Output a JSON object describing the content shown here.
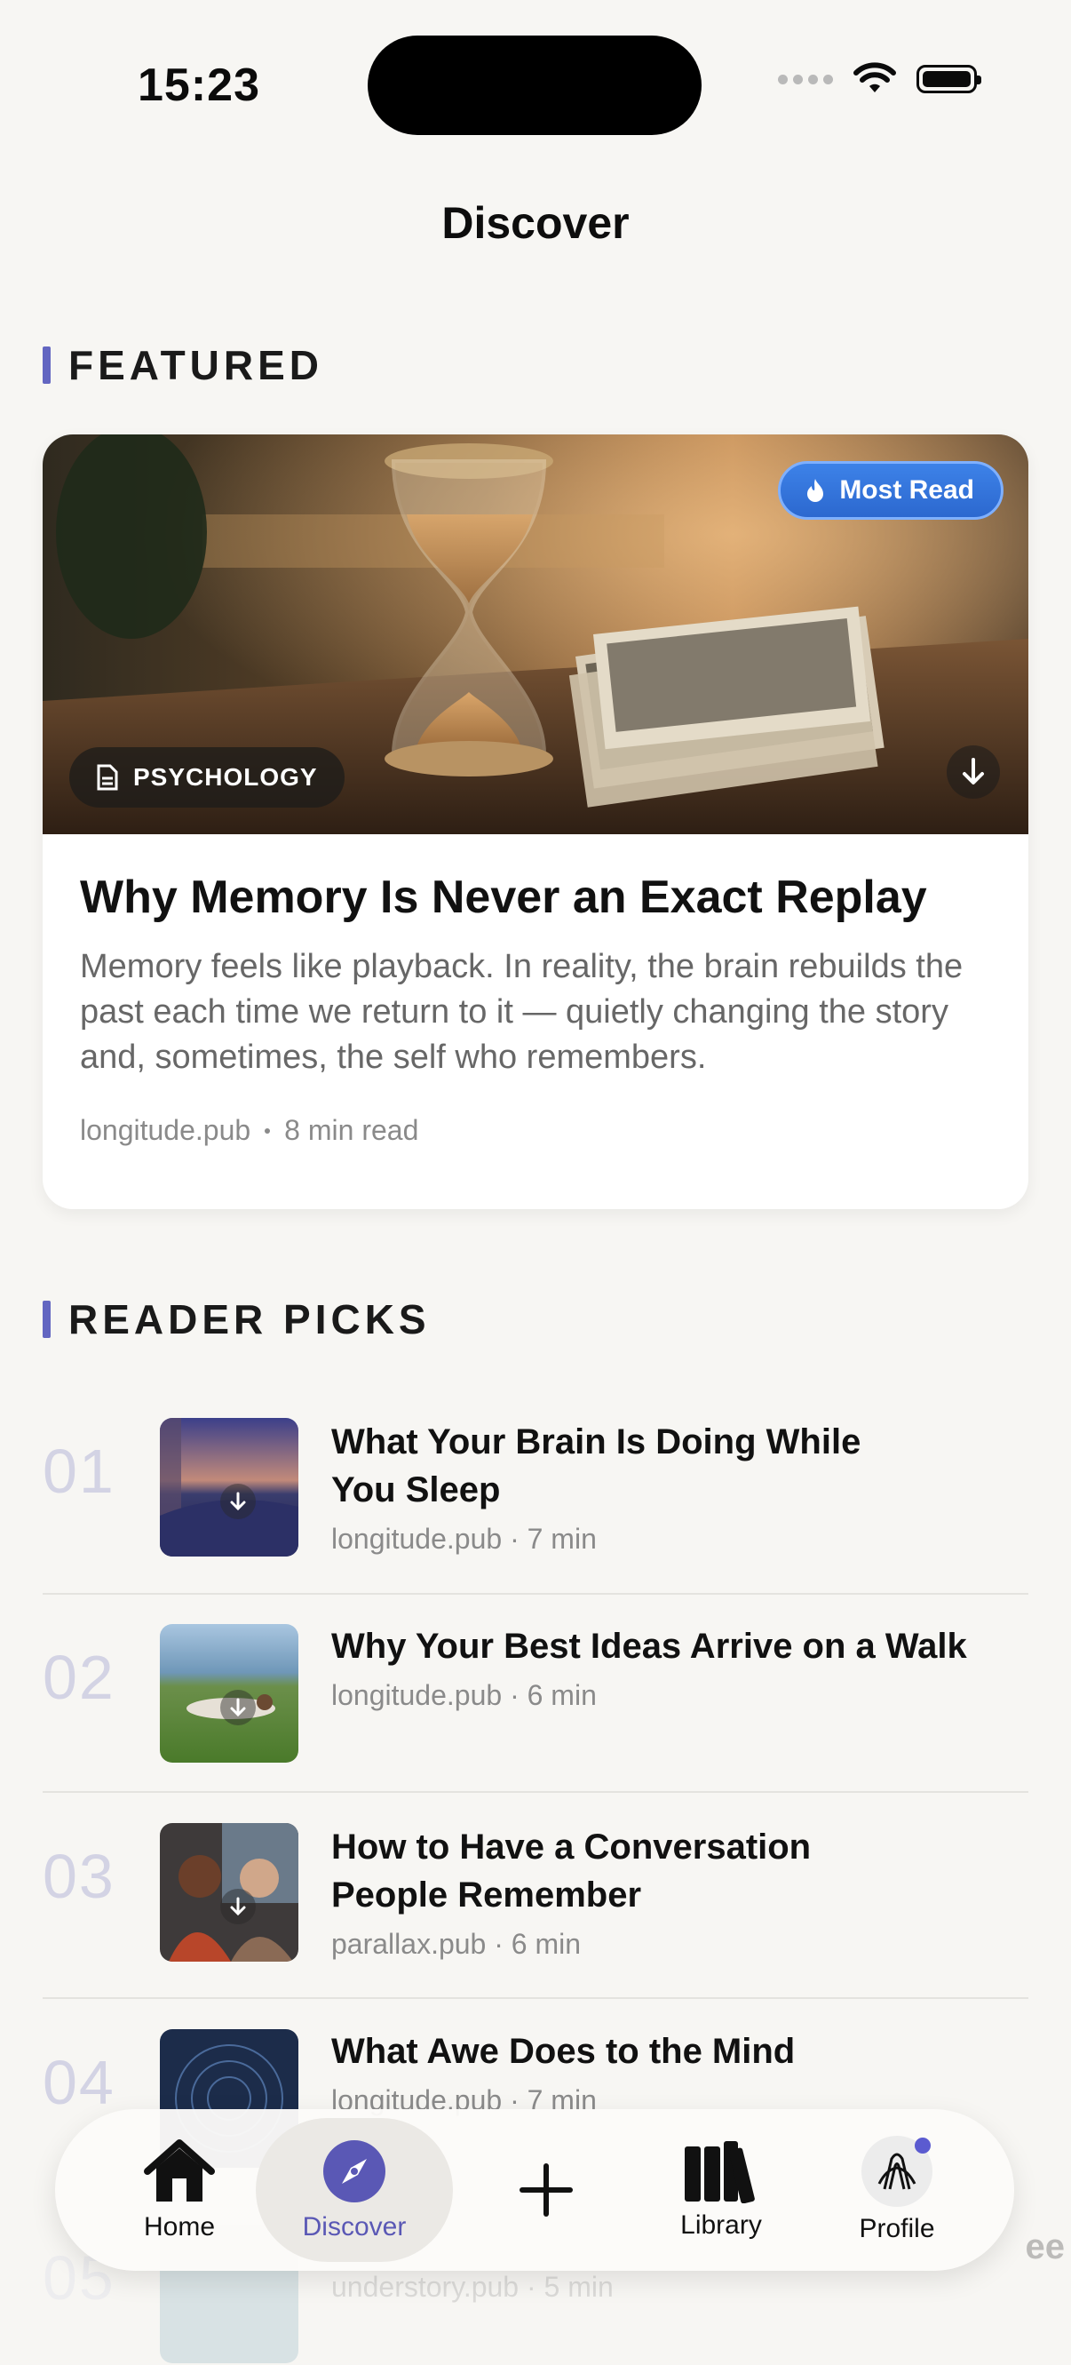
{
  "status": {
    "time": "15:23"
  },
  "header": {
    "title": "Discover"
  },
  "featured": {
    "section_label": "FEATURED",
    "badge": "Most Read",
    "category": "PSYCHOLOGY",
    "title": "Why Memory Is Never an Exact Replay",
    "excerpt": "Memory feels like playback. In reality, the brain rebuilds the past each time we return to it — quietly changing the story and, sometimes, the self who remembers.",
    "source": "longitude.pub",
    "read_time": "8 min read"
  },
  "picks": {
    "section_label": "READER PICKS",
    "items": [
      {
        "num": "01",
        "title": "What Your Brain Is Doing While You Sleep",
        "meta": "longitude.pub · 7 min"
      },
      {
        "num": "02",
        "title": "Why Your Best Ideas Arrive on a Walk",
        "meta": "longitude.pub · 6 min"
      },
      {
        "num": "03",
        "title": "How to Have a Conversation People Remember",
        "meta": "parallax.pub · 6 min"
      },
      {
        "num": "04",
        "title": "What Awe Does to the Mind",
        "meta": "longitude.pub · 7 min"
      },
      {
        "num": "05",
        "title": "ee",
        "meta": "understory.pub · 5 min"
      }
    ]
  },
  "tabbar": {
    "home": "Home",
    "discover": "Discover",
    "library": "Library",
    "profile": "Profile"
  },
  "colors": {
    "accent": "#5a58b5",
    "section_bar": "#6366c1",
    "badge_blue": "#2c68cf"
  }
}
